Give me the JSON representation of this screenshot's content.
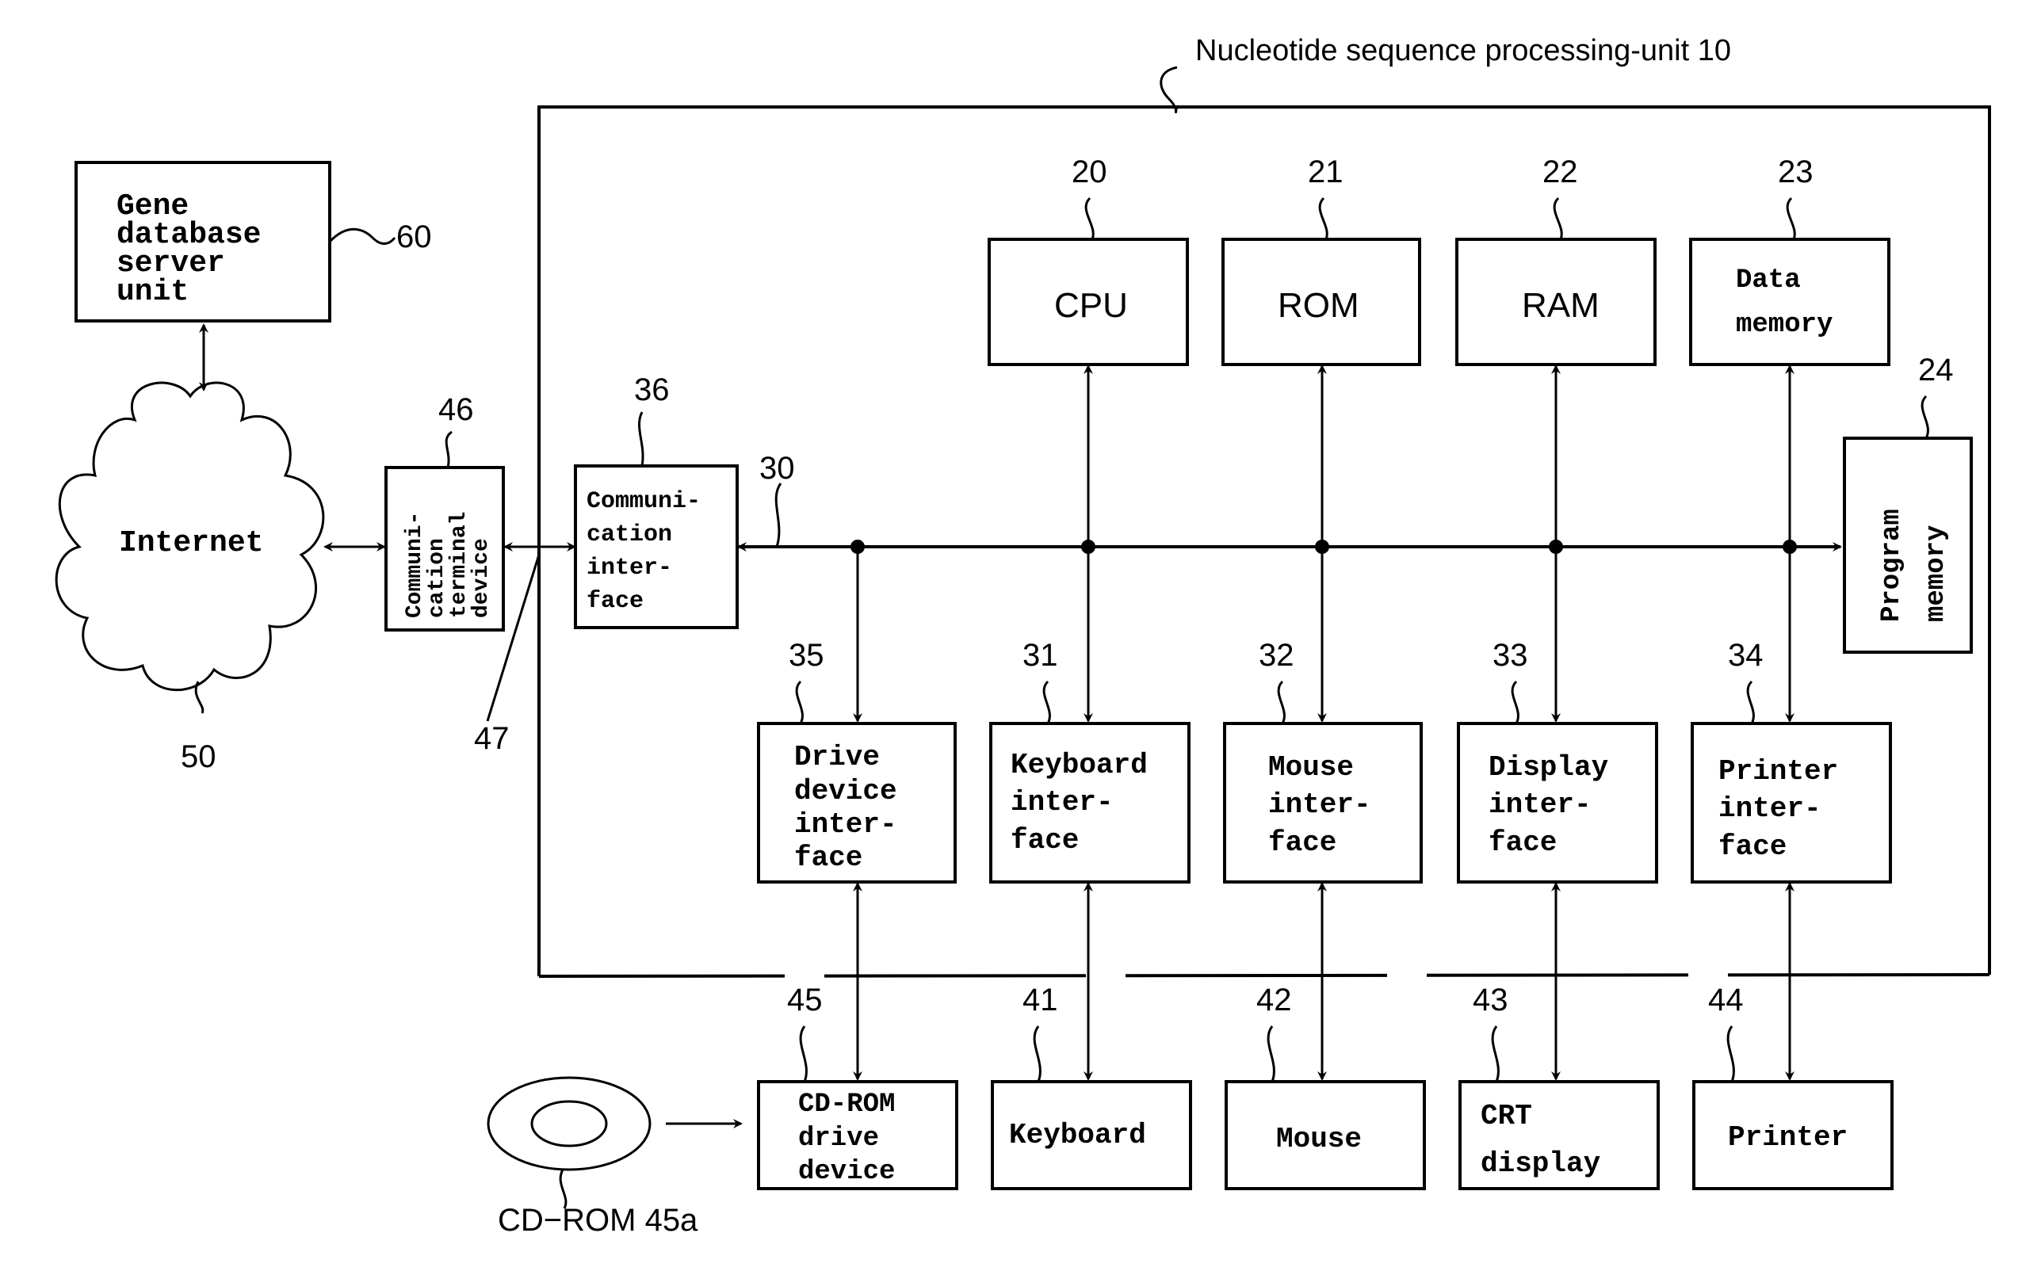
{
  "title": "Nucleotide sequence processing-unit 10",
  "external": {
    "gene_db": {
      "lines": [
        "Gene",
        "database",
        "server",
        "unit"
      ],
      "ref": "60"
    },
    "internet": {
      "label": "Internet",
      "ref": "50"
    },
    "comm_terminal": {
      "lines": [
        "Communi-",
        "cation",
        "terminal",
        "device"
      ],
      "ref": "46"
    },
    "line_ref": "47",
    "cdrom_media": {
      "label": "CD−ROM  45a"
    }
  },
  "unit": {
    "comm_interface": {
      "lines": [
        "Communi-",
        "cation",
        "inter-",
        "face"
      ],
      "ref": "36"
    },
    "bus_ref": "30",
    "top_row": [
      {
        "label": "CPU",
        "ref": "20"
      },
      {
        "label": "ROM",
        "ref": "21"
      },
      {
        "label": "RAM",
        "ref": "22"
      },
      {
        "lines": [
          "Data",
          "memory"
        ],
        "ref": "23"
      }
    ],
    "program_memory": {
      "lines": [
        "Program",
        "memory"
      ],
      "ref": "24"
    },
    "interfaces": [
      {
        "lines": [
          "Drive",
          "device",
          "inter-",
          "face"
        ],
        "ref": "35"
      },
      {
        "lines": [
          "Keyboard",
          "inter-",
          "face"
        ],
        "ref": "31"
      },
      {
        "lines": [
          "Mouse",
          "inter-",
          "face"
        ],
        "ref": "32"
      },
      {
        "lines": [
          "Display",
          "inter-",
          "face"
        ],
        "ref": "33"
      },
      {
        "lines": [
          "Printer",
          "inter-",
          "face"
        ],
        "ref": "34"
      }
    ]
  },
  "devices": [
    {
      "lines": [
        "CD-ROM",
        "drive",
        "device"
      ],
      "ref": "45"
    },
    {
      "lines": [
        "Keyboard"
      ],
      "ref": "41"
    },
    {
      "lines": [
        "Mouse"
      ],
      "ref": "42"
    },
    {
      "lines": [
        "CRT",
        "display"
      ],
      "ref": "43"
    },
    {
      "lines": [
        "Printer"
      ],
      "ref": "44"
    }
  ]
}
